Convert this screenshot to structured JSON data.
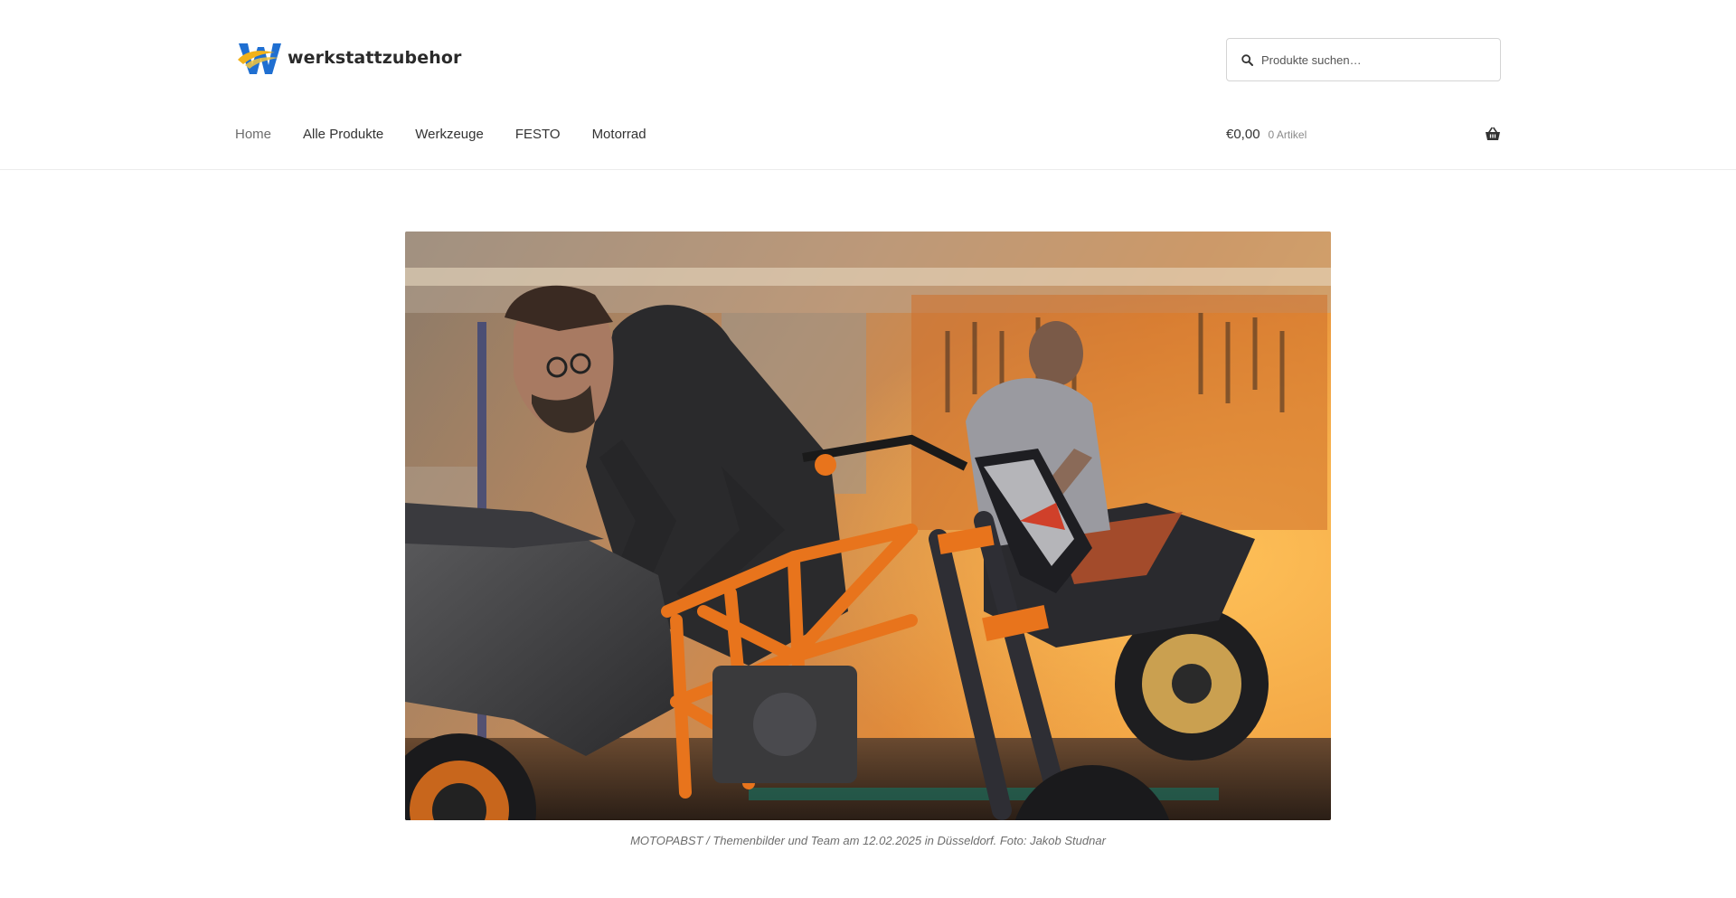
{
  "header": {
    "logo_text": "werkstattzubehor",
    "search": {
      "placeholder": "Produkte suchen…"
    },
    "nav": [
      {
        "label": "Home",
        "current": true
      },
      {
        "label": "Alle Produkte"
      },
      {
        "label": "Werkzeuge"
      },
      {
        "label": "FESTO"
      },
      {
        "label": "Motorrad"
      }
    ],
    "cart": {
      "amount": "€0,00",
      "count": "0 Artikel"
    }
  },
  "hero": {
    "image_icon": "motorcycle-workshop-photo",
    "caption": "MOTOPABST / Themenbilder und Team am 12.02.2025 in Düsseldorf. Foto: Jakob Studnar"
  },
  "colors": {
    "accent_orange": "#e8741c",
    "logo_blue": "#1f6fd1",
    "logo_yellow": "#f2b21a",
    "text": "#333333"
  }
}
